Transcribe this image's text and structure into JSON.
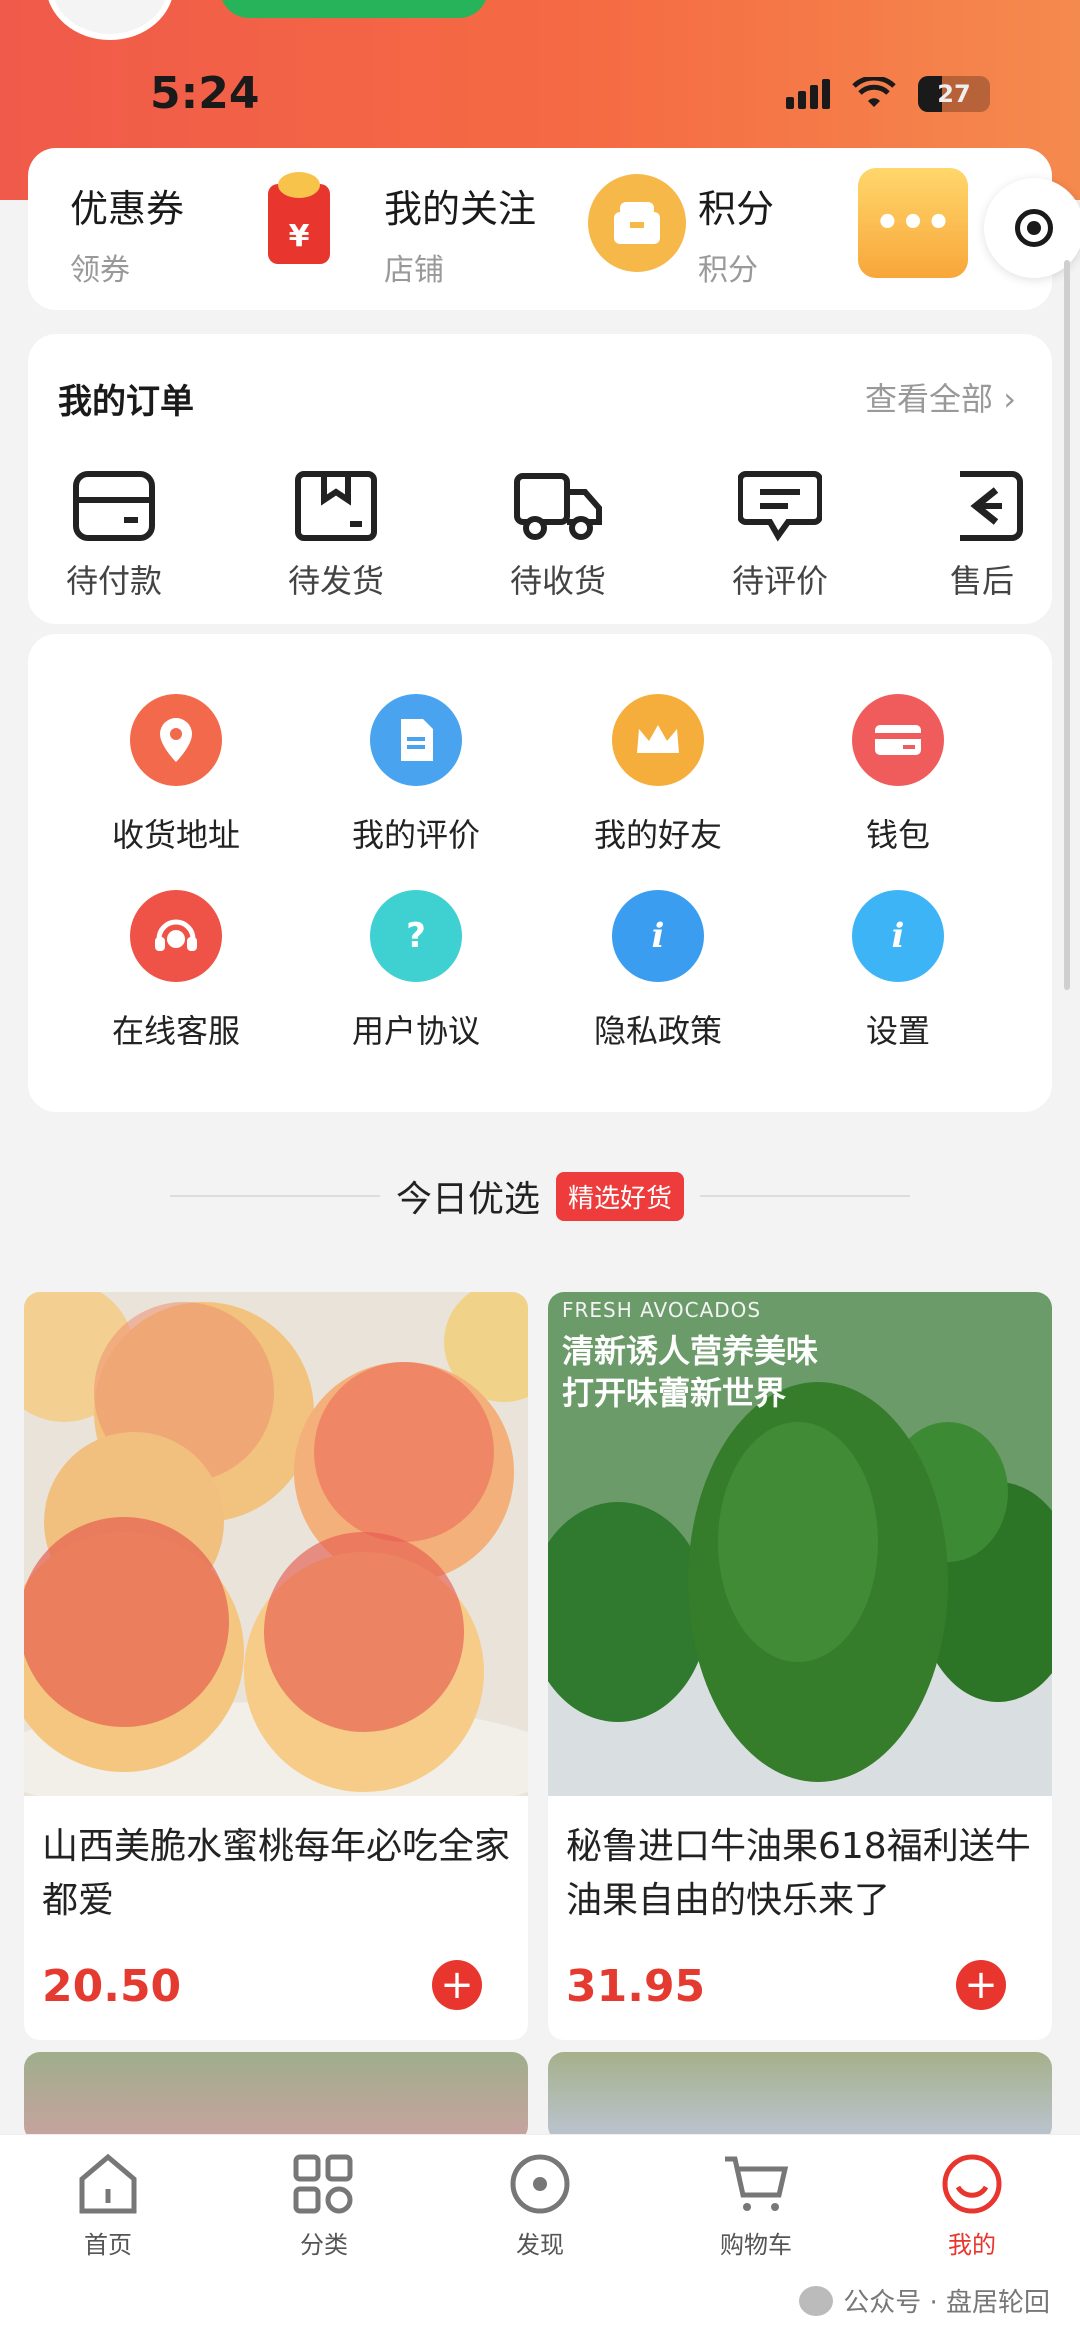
{
  "status": {
    "time": "5:24",
    "battery": "27"
  },
  "quick": [
    {
      "title": "优惠券",
      "sub": "领券",
      "icon": "coupon-icon"
    },
    {
      "title": "我的关注",
      "sub": "店铺",
      "icon": "store-icon"
    },
    {
      "title": "积分",
      "sub": "积分",
      "icon": "gift-box-icon"
    }
  ],
  "orders": {
    "title": "我的订单",
    "view_all": "查看全部 ›",
    "items": [
      "待付款",
      "待发货",
      "待收货",
      "待评价",
      "售后"
    ]
  },
  "services": [
    {
      "label": "收货地址",
      "color": "#f26a4b"
    },
    {
      "label": "我的评价",
      "color": "#4aa3ee"
    },
    {
      "label": "我的好友",
      "color": "#f5ae3b"
    },
    {
      "label": "钱包",
      "color": "#f05c5c"
    },
    {
      "label": "在线客服",
      "color": "#ef5246"
    },
    {
      "label": "用户协议",
      "color": "#3fd0d2"
    },
    {
      "label": "隐私政策",
      "color": "#3b9df0"
    },
    {
      "label": "设置",
      "color": "#3db4f5"
    }
  ],
  "section": {
    "title": "今日优选",
    "badge": "精选好货"
  },
  "products": [
    {
      "name": "山西美脆水蜜桃每年必吃全家都爱",
      "price": "20.50",
      "caption": ""
    },
    {
      "name": "秘鲁进口牛油果618福利送牛油果自由的快乐来了",
      "price": "31.95",
      "caption_small": "FRESH AVOCADOS",
      "caption_line1": "清新诱人营养美味",
      "caption_line2": "打开味蕾新世界"
    }
  ],
  "tabs": [
    "首页",
    "分类",
    "发现",
    "购物车",
    "我的"
  ],
  "watermark": "公众号 · 盘居轮回"
}
